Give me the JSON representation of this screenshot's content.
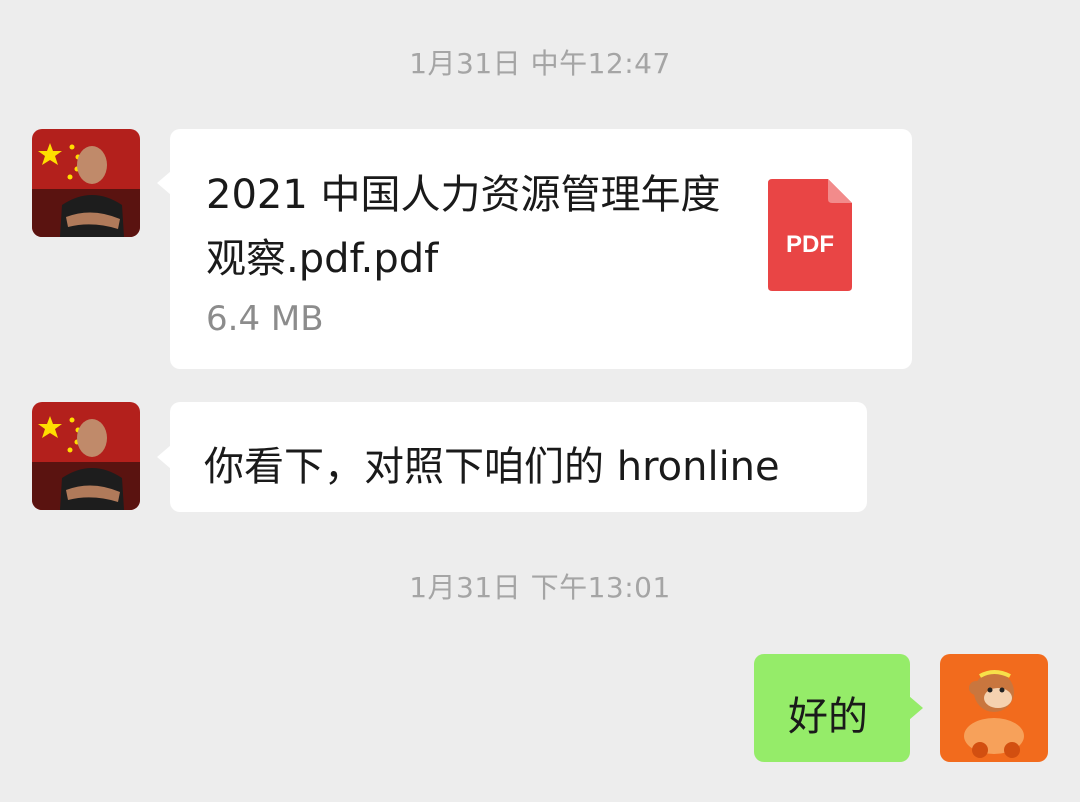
{
  "chat": {
    "timestamps": [
      "1月31日 中午12:47",
      "1月31日 下午13:01"
    ],
    "messages": [
      {
        "type": "file",
        "direction": "incoming",
        "avatar_icon": "contact-avatar-photo",
        "file": {
          "name": "2021 中国人力资源管理年度观察.pdf.pdf",
          "size": "6.4 MB",
          "icon": "pdf-file-icon",
          "icon_label": "PDF",
          "icon_color": "#e94545"
        }
      },
      {
        "type": "text",
        "direction": "incoming",
        "avatar_icon": "contact-avatar-photo",
        "text": "你看下，对照下咱们的 hronline"
      },
      {
        "type": "text",
        "direction": "outgoing",
        "avatar_icon": "self-avatar-monkey",
        "text": "好的"
      }
    ]
  },
  "colors": {
    "background": "#ededed",
    "incoming_bubble": "#ffffff",
    "outgoing_bubble": "#95ec69",
    "timestamp_text": "#a5a5a5",
    "file_size_text": "#8c8c8c"
  }
}
